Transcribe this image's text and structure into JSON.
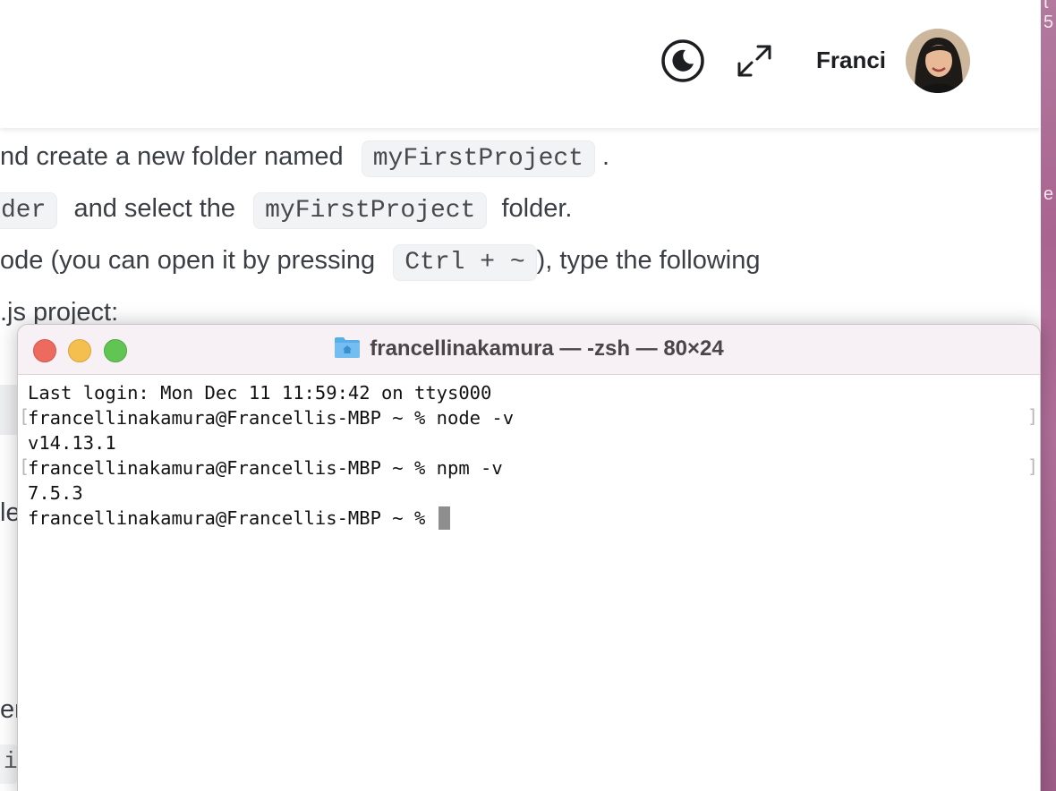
{
  "header": {
    "theme_toggle_icon": "moon-toggle-icon",
    "expand_icon": "expand-arrows-icon",
    "user_name": "Franci",
    "avatar_icon": "user-avatar"
  },
  "article": {
    "line1_prefix": "nd create a new folder named",
    "line1_code": "myFirstProject",
    "line1_suffix": ".",
    "line2_code_partial": "der",
    "line2_middle": "and select the",
    "line2_code": "myFirstProject",
    "line2_suffix": "folder.",
    "line3_prefix": "ode (you can open it by pressing",
    "line3_code": "Ctrl + ~",
    "line3_suffix": "), type the following",
    "line4_text": ".js project:",
    "left_fragment_1": "le",
    "left_fragment_2": "er",
    "left_fragment_3": "i"
  },
  "terminal": {
    "title": "francellinakamura — -zsh — 80×24",
    "title_icon": "home-folder-icon",
    "lines": [
      "Last login: Mon Dec 11 11:59:42 on ttys000",
      "francellinakamura@Francellis-MBP ~ % node -v",
      "v14.13.1",
      "francellinakamura@Francellis-MBP ~ % npm -v",
      "7.5.3",
      "francellinakamura@Francellis-MBP ~ % "
    ]
  },
  "colors": {
    "traffic_close": "#ed6a5e",
    "traffic_minimize": "#f5bf4f",
    "traffic_zoom": "#61c554",
    "desktop_wallpaper": "#a9648f"
  }
}
